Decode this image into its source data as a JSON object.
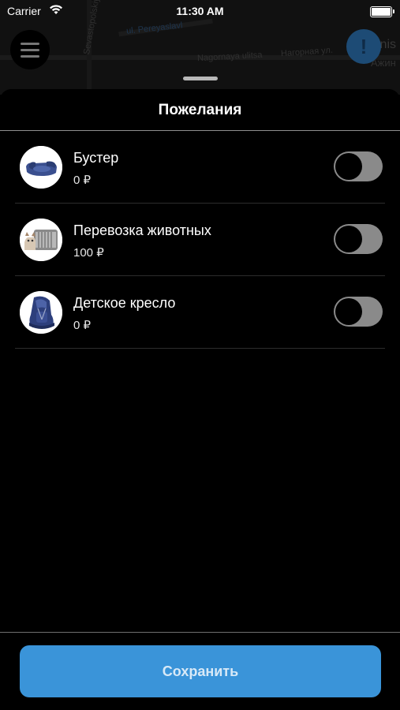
{
  "status_bar": {
    "carrier": "Carrier",
    "time": "11:30 AM"
  },
  "map": {
    "labels": {
      "street_vertical": "Sevastopolskiy",
      "street_blue": "ul. Pereyaslavl",
      "street_1": "Nagornaya ulitsa",
      "street_2": "Нагорная ул.",
      "place_1": "inis",
      "place_2": "Ажин"
    }
  },
  "sheet": {
    "title": "Пожелания",
    "items": [
      {
        "name": "Бустер",
        "price": "0 ₽",
        "enabled": false,
        "icon": "booster-seat-image"
      },
      {
        "name": "Перевозка животных",
        "price": "100 ₽",
        "enabled": false,
        "icon": "pet-carrier-image"
      },
      {
        "name": "Детское кресло",
        "price": "0 ₽",
        "enabled": false,
        "icon": "child-seat-image"
      }
    ]
  },
  "actions": {
    "save_label": "Сохранить"
  },
  "colors": {
    "accent": "#3a94d9",
    "background": "#000000",
    "toggle_off": "#8a8a8a"
  }
}
